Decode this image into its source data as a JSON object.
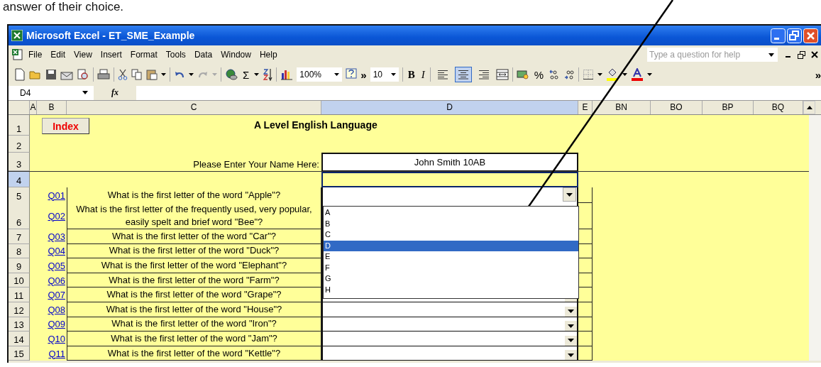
{
  "document_text": "answer of their choice.",
  "window": {
    "title": "Microsoft Excel - ET_SME_Example"
  },
  "menu": [
    "File",
    "Edit",
    "View",
    "Insert",
    "Format",
    "Tools",
    "Data",
    "Window",
    "Help"
  ],
  "help_box": {
    "placeholder": "Type a question for help"
  },
  "toolbar": {
    "zoom": "100%",
    "font_size": "10",
    "chevron": "»",
    "sigma": "Σ",
    "bold": "B",
    "italic": "I",
    "percent": "%",
    "alignment": [
      {
        "kind": "left",
        "selected": false
      },
      {
        "kind": "center",
        "selected": true
      },
      {
        "kind": "right",
        "selected": false
      }
    ]
  },
  "formula_bar": {
    "name_box": "D4",
    "fx": "fx"
  },
  "columns": [
    {
      "label": "A",
      "selected": false
    },
    {
      "label": "B",
      "selected": false
    },
    {
      "label": "C",
      "selected": false
    },
    {
      "label": "D",
      "selected": true
    },
    {
      "label": "E",
      "selected": false
    },
    {
      "label": "BN",
      "selected": false
    },
    {
      "label": "BO",
      "selected": false
    },
    {
      "label": "BP",
      "selected": false
    },
    {
      "label": "BQ",
      "selected": false
    }
  ],
  "row_numbers": [
    {
      "label": "1",
      "selected": false
    },
    {
      "label": "2",
      "selected": false
    },
    {
      "label": "3",
      "selected": false
    },
    {
      "label": "4",
      "selected": true
    },
    {
      "label": "5",
      "selected": false
    },
    {
      "label": "6",
      "selected": false
    },
    {
      "label": "7",
      "selected": false
    },
    {
      "label": "8",
      "selected": false
    },
    {
      "label": "9",
      "selected": false
    },
    {
      "label": "10",
      "selected": false
    },
    {
      "label": "11",
      "selected": false
    },
    {
      "label": "12",
      "selected": false
    },
    {
      "label": "13",
      "selected": false
    },
    {
      "label": "14",
      "selected": false
    },
    {
      "label": "15",
      "selected": false
    }
  ],
  "sheet": {
    "index_button": "Index",
    "heading": "A Level English Language",
    "name_prompt": "Please Enter Your Name Here:",
    "name_value": "John Smith 10AB"
  },
  "questions": [
    {
      "link": "Q01",
      "text": "What is the first letter of the word \"Apple\"?"
    },
    {
      "link": "Q02",
      "text": "What is the first letter of the frequently used, very popular, easily spelt and brief word \"Bee\"?"
    },
    {
      "link": "Q03",
      "text": "What is the first letter of the word \"Car\"?"
    },
    {
      "link": "Q04",
      "text": "What is the first letter of the word \"Duck\"?"
    },
    {
      "link": "Q05",
      "text": "What is the first letter of the word \"Elephant\"?"
    },
    {
      "link": "Q06",
      "text": "What is the first letter of the word \"Farm\"?"
    },
    {
      "link": "Q07",
      "text": "What is the first letter of the word \"Grape\"?"
    },
    {
      "link": "Q08",
      "text": "What is the first letter of the word \"House\"?"
    },
    {
      "link": "Q09",
      "text": "What is the first letter of the word \"Iron\"?"
    },
    {
      "link": "Q10",
      "text": "What is the first letter of the word \"Jam\"?"
    },
    {
      "link": "Q11",
      "text": "What is the first letter of the word \"Kettle\"?"
    }
  ],
  "dropdown_list": {
    "items": [
      {
        "label": "A",
        "selected": false
      },
      {
        "label": "B",
        "selected": false
      },
      {
        "label": "C",
        "selected": false
      },
      {
        "label": "D",
        "selected": true
      },
      {
        "label": "E",
        "selected": false
      },
      {
        "label": "F",
        "selected": false
      },
      {
        "label": "G",
        "selected": false
      },
      {
        "label": "H",
        "selected": false
      }
    ]
  }
}
